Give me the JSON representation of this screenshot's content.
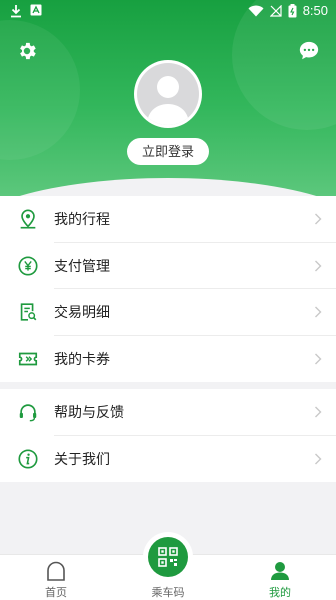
{
  "status_bar": {
    "time": "8:50"
  },
  "profile": {
    "login_label": "立即登录"
  },
  "menu_group1": [
    {
      "label": "我的行程",
      "icon": "location-pin-icon"
    },
    {
      "label": "支付管理",
      "icon": "yuan-icon"
    },
    {
      "label": "交易明细",
      "icon": "receipt-search-icon"
    },
    {
      "label": "我的卡券",
      "icon": "ticket-icon"
    }
  ],
  "menu_group2": [
    {
      "label": "帮助与反馈",
      "icon": "headset-icon"
    },
    {
      "label": "关于我们",
      "icon": "info-icon"
    }
  ],
  "tabs": [
    {
      "label": "首页",
      "icon": "home-icon"
    },
    {
      "label": "乘车码",
      "icon": "qr-code-icon"
    },
    {
      "label": "我的",
      "icon": "person-icon"
    }
  ],
  "colors": {
    "accent": "#1f9a3f",
    "header_top": "#17a040",
    "header_bottom": "#5cc77c"
  }
}
